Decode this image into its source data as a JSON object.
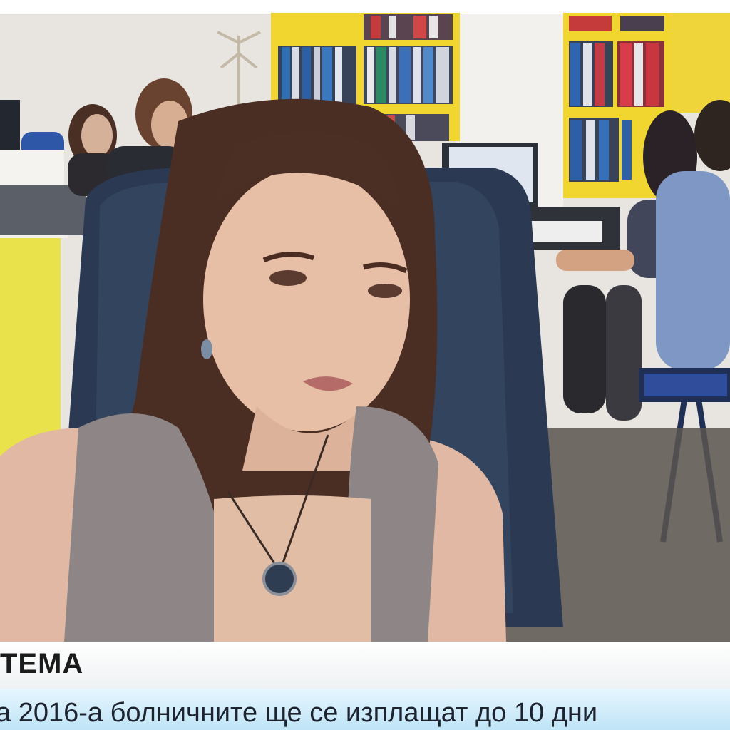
{
  "lower_third": {
    "topic": "ТЕМА",
    "headline": "а 2016-а болничните ще се изплащат до 10 дни"
  },
  "colors": {
    "topic_bar": "#f2f4f5",
    "headline_bar": "#cdeaf8",
    "shelf_yellow": "#f0d830",
    "wall": "#e9e4de",
    "chair": "#2b3a52"
  }
}
